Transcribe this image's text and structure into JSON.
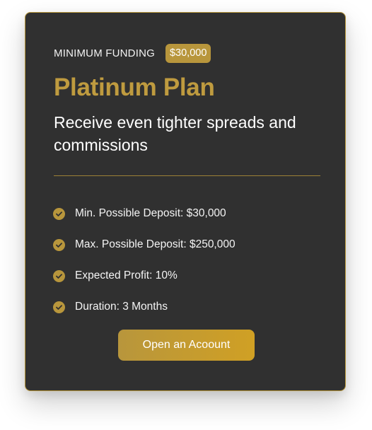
{
  "card": {
    "funding_label": "MINIMUM FUNDING",
    "funding_amount": "$30,000",
    "title": "Platinum Plan",
    "description": "Receive even tighter spreads and commissions",
    "features": [
      {
        "text": "Min. Possible Deposit: $30,000",
        "icon": "check-circle-icon"
      },
      {
        "text": "Max. Possible Deposit: $250,000",
        "icon": "check-circle-icon"
      },
      {
        "text": "Expected Profit: 10%",
        "icon": "check-circle-icon"
      },
      {
        "text": "Duration: 3 Months",
        "icon": "check-circle-icon"
      }
    ],
    "cta_label": "Open an Acoount"
  },
  "colors": {
    "card_background": "#303030",
    "accent_gold": "#b8963c",
    "title_gold": "#bf9b3f",
    "text": "#ffffff"
  }
}
